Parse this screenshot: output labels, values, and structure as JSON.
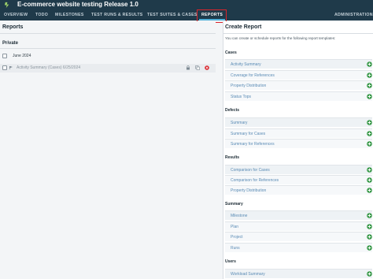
{
  "header": {
    "title": "E-commerce website testing Release 1.0"
  },
  "nav": {
    "items": [
      {
        "label": "OVERVIEW"
      },
      {
        "label": "TODO"
      },
      {
        "label": "MILESTONES"
      },
      {
        "label": "TEST RUNS & RESULTS"
      },
      {
        "label": "TEST SUITES & CASES"
      },
      {
        "label": "REPORTS"
      }
    ],
    "admin_label": "ADMINISTRATION",
    "active": "REPORTS"
  },
  "left": {
    "title": "Reports",
    "private_title": "Private",
    "group_label": "June 2024",
    "report_label": "Activity Summary (Cases) 6/25/2024"
  },
  "right": {
    "title": "Create Report",
    "description": "You can create or schedule reports for the following report templates:",
    "sections": [
      {
        "title": "Cases",
        "items": [
          "Activity Summary",
          "Coverage for References",
          "Property Distribution",
          "Status Tops"
        ]
      },
      {
        "title": "Defects",
        "items": [
          "Summary",
          "Summary for Cases",
          "Summary for References"
        ]
      },
      {
        "title": "Results",
        "items": [
          "Comparison for Cases",
          "Comparison for References",
          "Property Distribution"
        ]
      },
      {
        "title": "Summary",
        "items": [
          "Milestone",
          "Plan",
          "Project",
          "Runs"
        ]
      },
      {
        "title": "Users",
        "items": [
          "Workload Summary"
        ]
      }
    ]
  },
  "colors": {
    "header_bg": "#1f3a4a",
    "link": "#5a8bb5",
    "add_green": "#3a9a4a",
    "delete_red": "#d9242b",
    "highlight": "#d9242b"
  },
  "icons": {
    "logo": "logo-icon",
    "flag": "flag-icon",
    "lock": "lock-icon",
    "copy": "copy-icon",
    "delete": "delete-icon",
    "add": "plus-icon"
  }
}
